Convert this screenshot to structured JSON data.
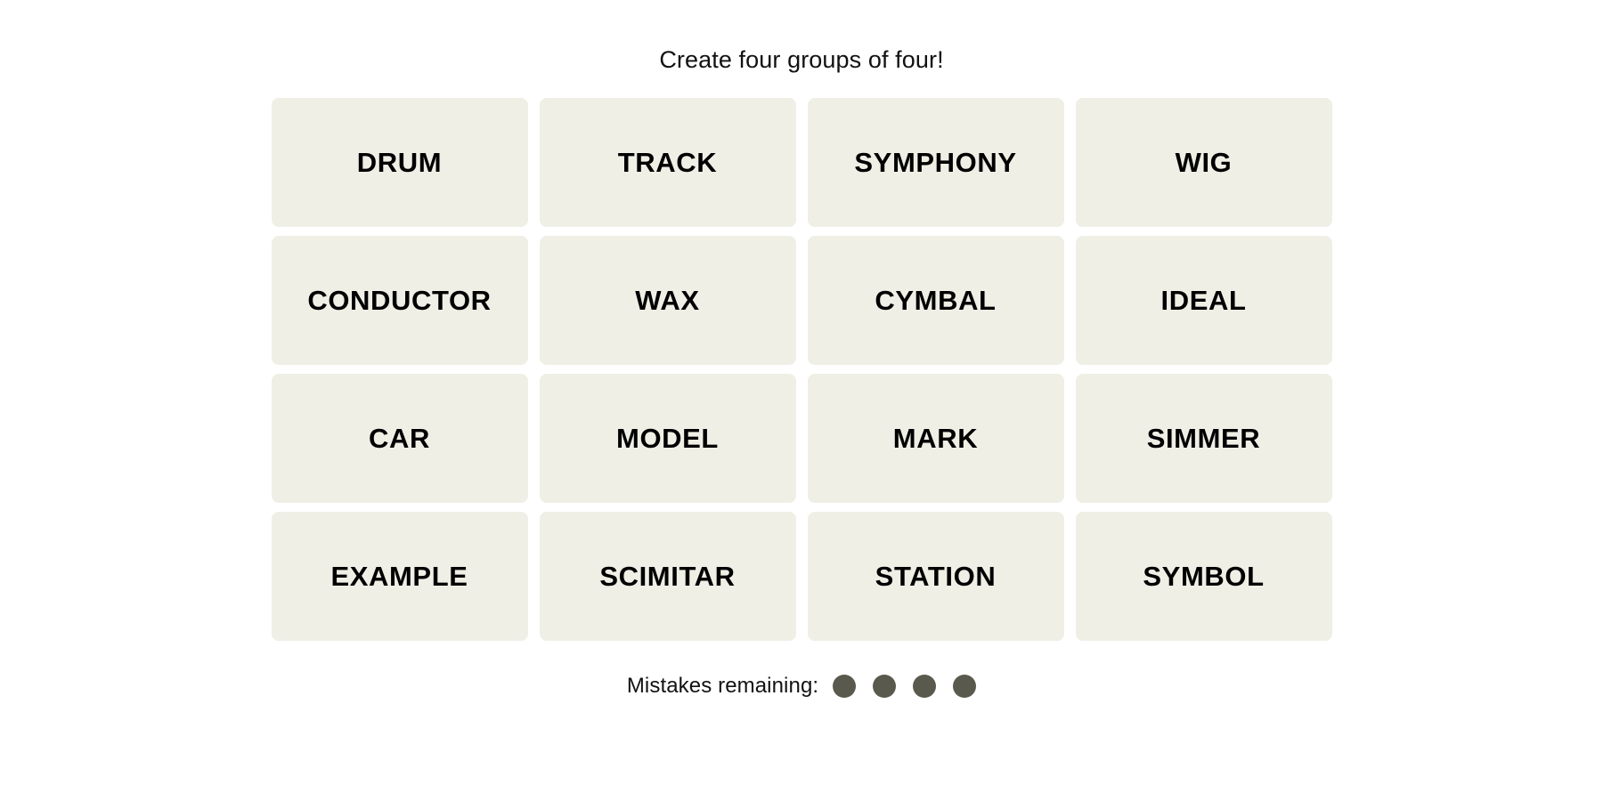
{
  "header": {
    "title": "Create four groups of four!"
  },
  "board": {
    "rows": 4,
    "columns": 4,
    "tiles": [
      {
        "label": "DRUM"
      },
      {
        "label": "TRACK"
      },
      {
        "label": "SYMPHONY"
      },
      {
        "label": "WIG"
      },
      {
        "label": "CONDUCTOR"
      },
      {
        "label": "WAX"
      },
      {
        "label": "CYMBAL"
      },
      {
        "label": "IDEAL"
      },
      {
        "label": "CAR"
      },
      {
        "label": "MODEL"
      },
      {
        "label": "MARK"
      },
      {
        "label": "SIMMER"
      },
      {
        "label": "EXAMPLE"
      },
      {
        "label": "SCIMITAR"
      },
      {
        "label": "STATION"
      },
      {
        "label": "SYMBOL"
      }
    ]
  },
  "footer": {
    "mistakes_label": "Mistakes remaining:",
    "mistakes_remaining": 4,
    "dots": [
      {
        "name": "mistake-dot-1"
      },
      {
        "name": "mistake-dot-2"
      },
      {
        "name": "mistake-dot-3"
      },
      {
        "name": "mistake-dot-4"
      }
    ]
  },
  "colors": {
    "page_background": "#FFFFFF",
    "tile_background": "#EFEFE6",
    "tile_text": "#000000",
    "title_text": "#121212",
    "dot_fill": "#5A594E"
  }
}
